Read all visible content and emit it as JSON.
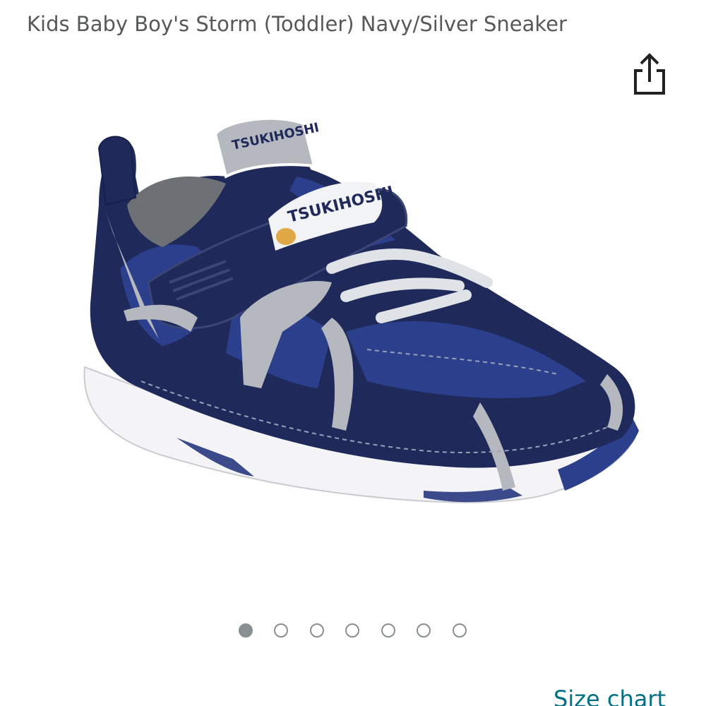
{
  "product": {
    "title": "Kids Baby Boy's Storm (Toddler) Navy/Silver Sneaker",
    "image": {
      "brand_text": "TSUKIHOSHI",
      "heel_tab_text": "TSUKIHOSHI"
    }
  },
  "share": {
    "icon": "share-icon"
  },
  "carousel": {
    "total": 7,
    "active_index": 0
  },
  "links": {
    "size_chart": "Size chart"
  },
  "colors": {
    "navy": "#1f2a5a",
    "mesh_blue": "#2b3f8c",
    "silver": "#b5b9bf",
    "sole_white": "#f4f4f6",
    "link": "#007185",
    "title_text": "#565959"
  }
}
